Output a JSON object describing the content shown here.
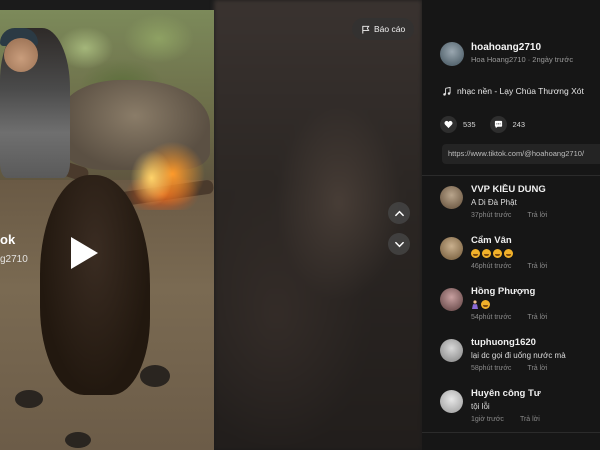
{
  "video": {
    "watermark": "ok",
    "watermark_sub": "g2710",
    "report_label": "Báo cáo"
  },
  "author": {
    "username": "hoahoang2710",
    "subtitle": "Hoa Hoang2710 · 2ngày trước"
  },
  "music": {
    "label": "nhạc nền - Lạy Chúa Thương Xót"
  },
  "stats": {
    "likes": "535",
    "comments": "243"
  },
  "link": {
    "url": "https://www.tiktok.com/@hoahoang2710/"
  },
  "comments": [
    {
      "name": "VVP KIỀU DUNG",
      "text": "A Di Đà Phật",
      "time": "37phút trước",
      "reply": "Trả lời"
    },
    {
      "name": "Cẩm Vân",
      "text": "",
      "time": "46phút trước",
      "reply": "Trả lời"
    },
    {
      "name": "Hồng Phượng",
      "text": "",
      "time": "54phút trước",
      "reply": "Trả lời"
    },
    {
      "name": "tuphuong1620",
      "text": "lại dc gọi đi uống nước mà",
      "time": "58phút trước",
      "reply": "Trả lời"
    },
    {
      "name": "Huyên công Tư",
      "text": "tội lỗi",
      "time": "1giờ trước",
      "reply": "Trả lời"
    }
  ],
  "icons": {
    "play": "play-icon",
    "flag": "flag-icon",
    "up": "chevron-up-icon",
    "down": "chevron-down-icon",
    "music": "music-note-icon",
    "heart": "heart-icon",
    "comment": "comment-icon"
  },
  "colors": {
    "panel_bg": "#161616",
    "video_bg": "#1b1b1b",
    "text_primary": "#f0f0f0",
    "text_secondary": "#8a8a8a"
  }
}
